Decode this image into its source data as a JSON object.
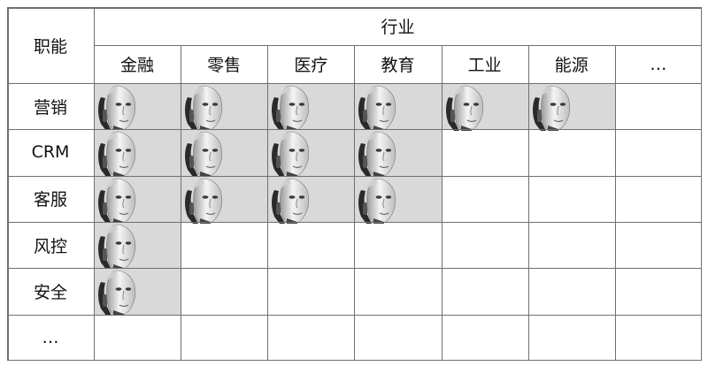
{
  "table": {
    "corner_label": "职能",
    "group_header": "行业",
    "industries": [
      "金融",
      "零售",
      "医疗",
      "教育",
      "工业",
      "能源",
      "…"
    ],
    "functions": [
      "营销",
      "CRM",
      "客服",
      "风控",
      "安全",
      "…"
    ],
    "adoption": [
      [
        1,
        1,
        1,
        1,
        1,
        1,
        0
      ],
      [
        1,
        1,
        1,
        1,
        0,
        0,
        0
      ],
      [
        1,
        1,
        1,
        1,
        0,
        0,
        0
      ],
      [
        1,
        0,
        0,
        0,
        0,
        0,
        0
      ],
      [
        1,
        0,
        0,
        0,
        0,
        0,
        0
      ],
      [
        0,
        0,
        0,
        0,
        0,
        0,
        0
      ]
    ],
    "marker_icon": "humanoid-robot-head-icon",
    "filled_color": "#d9d9d9",
    "line_color": "#6f6f6f"
  }
}
